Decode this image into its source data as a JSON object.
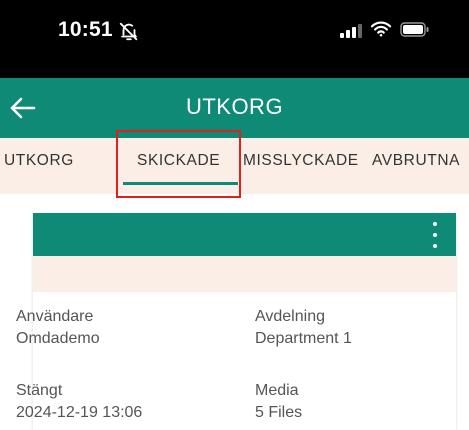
{
  "status_bar": {
    "time": "10:51",
    "icons": [
      "bell-slash-icon",
      "cellular-signal-icon",
      "wifi-icon",
      "battery-icon"
    ]
  },
  "app_bar": {
    "title": "UTKORG",
    "back_icon": "arrow-left-icon",
    "color": "#0f8a76"
  },
  "tabs": [
    {
      "label": "UTKORG",
      "selected": false
    },
    {
      "label": "SKICKADE",
      "selected": true
    },
    {
      "label": "MISSLYCKADE",
      "selected": false
    },
    {
      "label": "AVBRUTNA",
      "selected": false
    }
  ],
  "card": {
    "menu_icon": "more-vertical-icon",
    "fields": {
      "user": {
        "label": "Användare",
        "value": "Omdademo"
      },
      "department": {
        "label": "Avdelning",
        "value": "Department 1"
      },
      "closed": {
        "label": "Stängt",
        "value": "2024-12-19 13:06"
      },
      "media": {
        "label": "Media",
        "value": "5 Files"
      }
    }
  },
  "colors": {
    "accent": "#0f8a76",
    "tab_background": "#fbeee7",
    "highlight": "#e0201d"
  }
}
